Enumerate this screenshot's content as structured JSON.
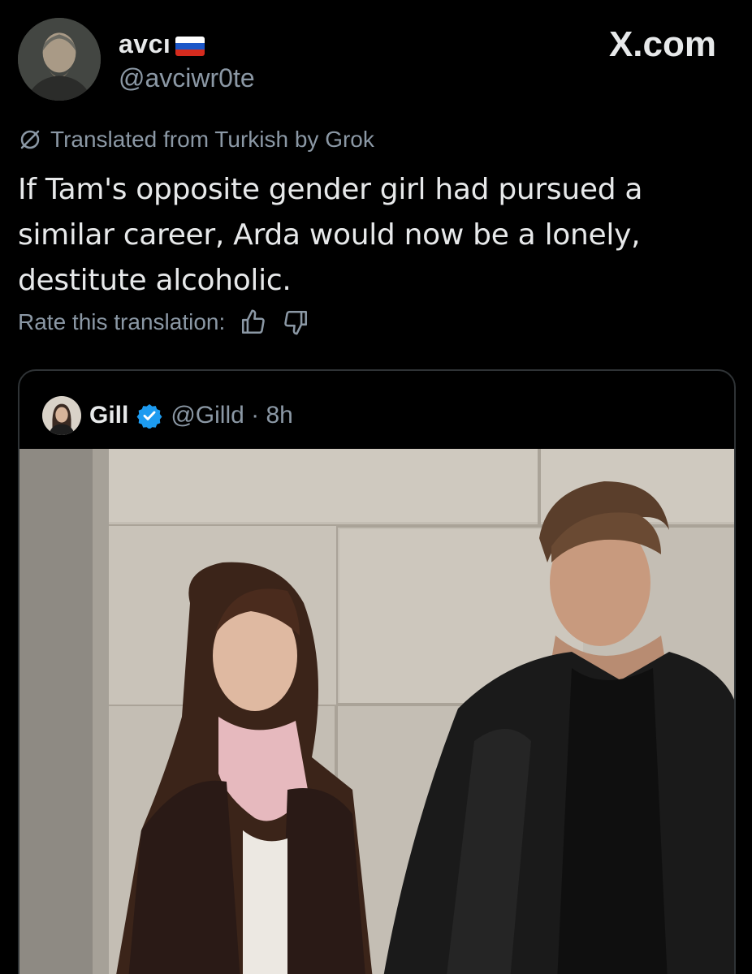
{
  "author": {
    "display_name": "avcı",
    "handle": "@avciwr0te",
    "avatar_icon": "profile-photo"
  },
  "brand": {
    "label": "X.com"
  },
  "translation": {
    "notice": "Translated from Turkish by Grok",
    "rate_label": "Rate this translation:"
  },
  "tweet": {
    "text": "If Tam's opposite gender girl had pursued a similar career, Arda would now be a lonely, destitute alcoholic."
  },
  "quoted": {
    "display_name": "Gill",
    "handle": "@Gilld",
    "separator": "·",
    "time": "8h",
    "verified_color": "#1d9bf0"
  },
  "colors": {
    "background": "#000000",
    "text_primary": "#e7e9ea",
    "text_secondary": "#8b98a5",
    "border": "#2f3336"
  }
}
